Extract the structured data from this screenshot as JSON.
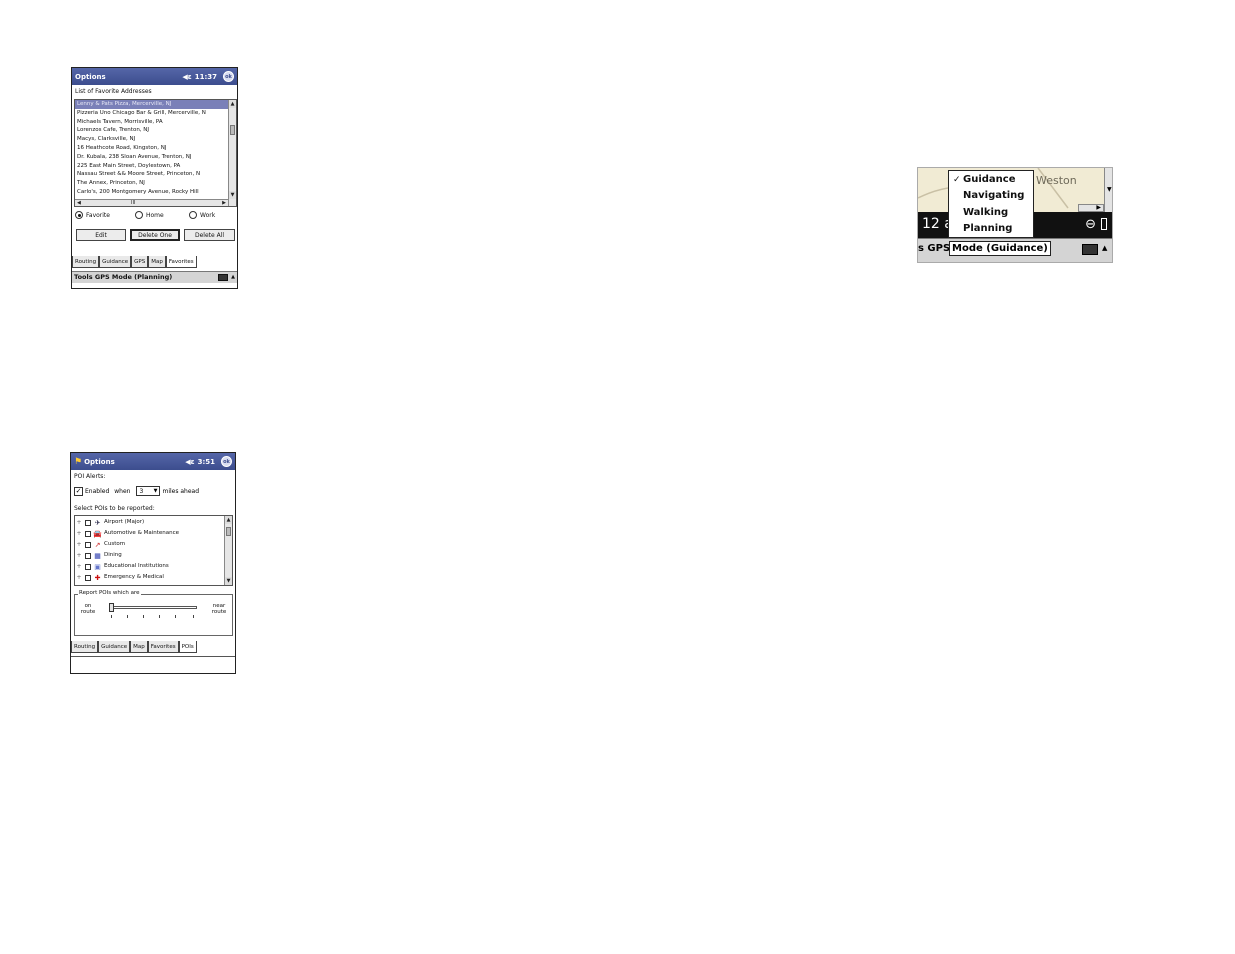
{
  "favorites_screen": {
    "title": "Options",
    "clock": "11:37",
    "speaker_icon": "speaker-icon",
    "ok_icon": "ok-icon",
    "list_label": "List of Favorite Addresses",
    "addresses": [
      "Lenny & Pats Pizza, Mercerville, NJ",
      "Pizzeria Uno Chicago Bar & Grill, Mercerville, N",
      "Michaels Tavern, Morrisville, PA",
      "Lorenzos Cafe, Trenton, NJ",
      "Macys, Clarksville, NJ",
      "16 Heathcote Road, Kingston, NJ",
      "Dr. Kubala, 238 Sloan Avenue, Trenton, NJ",
      "225 East Main Street, Doylestown, PA",
      "Nassau Street && Moore Street, Princeton, N",
      "The Annex, Princeton, NJ",
      "Carlo's, 200 Montgomery Avenue, Rocky Hill"
    ],
    "selected_index": 0,
    "radios": [
      "Favorite",
      "Home",
      "Work"
    ],
    "selected_radio": "Favorite",
    "buttons": {
      "edit": "Edit",
      "delete_one": "Delete One",
      "delete_all": "Delete All"
    },
    "tabs": [
      "Routing",
      "Guidance",
      "GPS",
      "Map",
      "Favorites"
    ],
    "active_tab": "Favorites",
    "menubar": "Tools GPS Mode (Planning)"
  },
  "pois_screen": {
    "title": "Options",
    "clock": "3:51",
    "start_icon": "windows-flag-icon",
    "alerts_label": "POI Alerts:",
    "enabled_label": "Enabled",
    "enabled_checked": true,
    "when_label": "when",
    "miles_value": "3",
    "miles_label": "miles ahead",
    "select_label": "Select POIs to be reported:",
    "categories": [
      {
        "label": "Airport (Major)",
        "icon": "airplane-icon"
      },
      {
        "label": "Automotive & Maintenance",
        "icon": "car-icon"
      },
      {
        "label": "Custom",
        "icon": "pin-icon"
      },
      {
        "label": "Dining",
        "icon": "dining-icon"
      },
      {
        "label": "Educational Institutions",
        "icon": "school-icon"
      },
      {
        "label": "Emergency & Medical",
        "icon": "medical-cross-icon"
      }
    ],
    "group_label": "Report POIs which are",
    "slider_left": "on\nroute",
    "slider_right": "near\nroute",
    "slider_position": 0,
    "tabs": [
      "Routing",
      "Guidance",
      "Map",
      "Favorites",
      "POIs"
    ],
    "active_tab": "POIs"
  },
  "mode_popup": {
    "map_label": "Weston",
    "clock_fragment": "12 a",
    "menubar_prefix": "s GPS",
    "menubar_text": "Mode (Guidance)",
    "items": [
      "Guidance",
      "Navigating",
      "Walking",
      "Planning"
    ],
    "checked_item": "Guidance"
  }
}
